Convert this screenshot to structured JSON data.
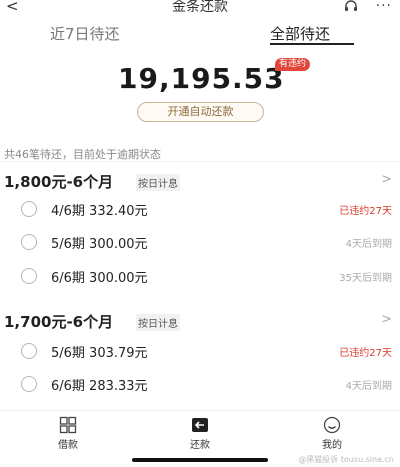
{
  "header": {
    "title": "金条还款",
    "back_glyph": "<",
    "more_glyph": "···",
    "icons": [
      "back-icon",
      "headset-icon",
      "more-icon"
    ]
  },
  "tabs": [
    {
      "label": "近7日待还",
      "active": false
    },
    {
      "label": "全部待还",
      "active": true
    }
  ],
  "total": {
    "amount": "19,195.53",
    "badge": "有违约",
    "badge_color": "#e0463a"
  },
  "autopay_label": "开通自动还款",
  "summary": "共46笔待还，目前处于逾期状态",
  "groups": [
    {
      "title": "1,800元-6个月",
      "tag": "按日计息",
      "chevron": ">",
      "items": [
        {
          "period": "4/6期  332.40元",
          "status": "已违约27天",
          "overdue": true
        },
        {
          "period": "5/6期  300.00元",
          "status": "4天后到期",
          "overdue": false
        },
        {
          "period": "6/6期  300.00元",
          "status": "35天后到期",
          "overdue": false
        }
      ]
    },
    {
      "title": "1,700元-6个月",
      "tag": "按日计息",
      "chevron": ">",
      "items": [
        {
          "period": "5/6期  303.79元",
          "status": "已违约27天",
          "overdue": true
        },
        {
          "period": "6/6期  283.33元",
          "status": "4天后到期",
          "overdue": false
        }
      ]
    }
  ],
  "bottom_nav": [
    {
      "label": "借款",
      "icon": "grid-icon"
    },
    {
      "label": "还款",
      "icon": "arrow-left-box-icon"
    },
    {
      "label": "我的",
      "icon": "smile-face-icon"
    }
  ],
  "watermark": "@黑猫投诉 tousu.sina.cn",
  "colors": {
    "overdue_red": "#d93a2b",
    "autopay_border": "#c9b59a",
    "autopay_text": "#8a6a3e"
  }
}
